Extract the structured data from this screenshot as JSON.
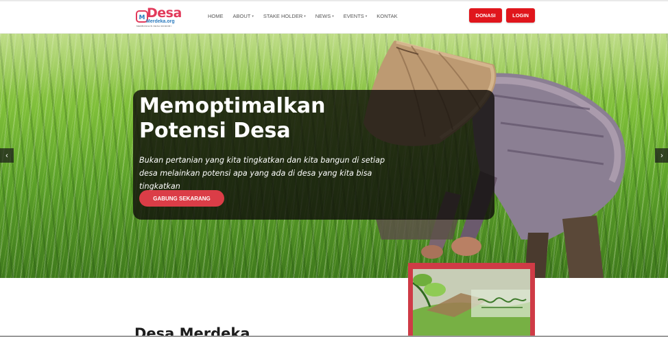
{
  "header": {
    "logo_text": "Desa",
    "logo_sub": "Merdeka.org",
    "logo_tagline": "MEMBANGUN DESA MANDIRI",
    "nav": [
      {
        "label": "HOME",
        "dropdown": false
      },
      {
        "label": "ABOUT",
        "dropdown": true
      },
      {
        "label": "STAKE HOLDER",
        "dropdown": true
      },
      {
        "label": "NEWS",
        "dropdown": true
      },
      {
        "label": "EVENTS",
        "dropdown": true
      },
      {
        "label": "KONTAK",
        "dropdown": false
      }
    ],
    "donate_label": "DONASI",
    "login_label": "LOGIN"
  },
  "hero": {
    "title": "Memoptimalkan Potensi Desa",
    "subtitle": "Bukan pertanian yang kita tingkatkan dan kita bangun di setiap desa melainkan potensi apa yang ada di desa yang kita bisa tingkatkan",
    "cta_label": "GABUNG SEKARANG",
    "prev_icon": "‹",
    "next_icon": "›"
  },
  "section": {
    "title": "Desa Merdeka"
  },
  "colors": {
    "brand_red": "#e0161c",
    "cta_red": "#db3d47",
    "logo_pink": "#e23a5b",
    "logo_blue": "#2d7cbf"
  }
}
